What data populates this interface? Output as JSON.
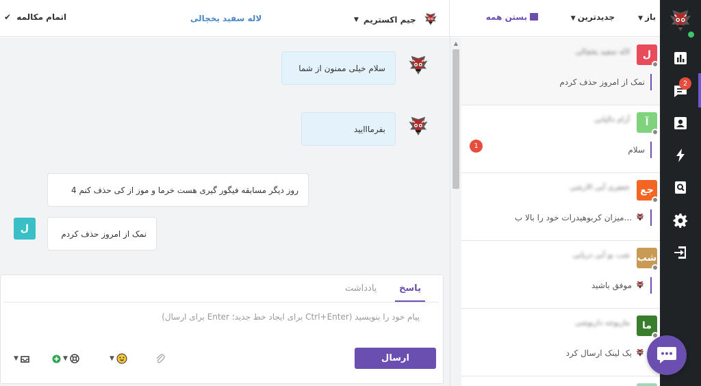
{
  "header": {
    "filter_open": "باز",
    "sort_newest": "جدیدترین",
    "close_all": "بستن همه",
    "finish_chat": "اتمام مکالمه",
    "contact_name": "لاله سفید یخچالی",
    "agent_name": "جیم اکستریم"
  },
  "nav": {
    "badge": "2",
    "icons": [
      "bar-chart-icon",
      "chat-icon",
      "contact-card-icon",
      "lightning-icon",
      "search-doc-icon",
      "gear-icon",
      "logout-icon"
    ]
  },
  "conversations": [
    {
      "avatar": "ل",
      "color": "#e84c5a",
      "name": "لاله سفید یخچالی",
      "last": "نمک از امروز حذف کردم",
      "unread": "",
      "agent_logo": false
    },
    {
      "avatar": "آ",
      "color": "#6fcf71",
      "name": "آرام دالیانی",
      "last": "سلام",
      "unread": "1",
      "agent_logo": false
    },
    {
      "avatar": "جع",
      "color": "#f26522",
      "name": "جعفری آیی الارشی",
      "last": "میزان کربوهیدرات خود را بالا ب...",
      "unread": "",
      "agent_logo": true
    },
    {
      "avatar": "شب",
      "color": "#c99a54",
      "name": "شب بو آبی دریایی",
      "last": "موفق باشید",
      "unread": "",
      "agent_logo": true
    },
    {
      "avatar": "ما",
      "color": "#3a7d2c",
      "name": "ماریوجه داریوشی",
      "last": "یک لینک ارسال کرد",
      "unread": "",
      "agent_logo": true
    }
  ],
  "messages": [
    {
      "text": "سلام خیلی ممنون از شما",
      "dir": "out"
    },
    {
      "text": "بفرمااایید",
      "dir": "out"
    },
    {
      "text": "4 روز دیگر مسابقه فیگور گیری هست خرما و موز از کی حذف کنم",
      "dir": "in"
    },
    {
      "text": "نمک از امروز حذف کردم",
      "dir": "in",
      "avatar": "ل"
    }
  ],
  "reply": {
    "tab_reply": "پاسخ",
    "tab_note": "یادداشت",
    "placeholder": "پیام خود را بنویسید (Ctrl+Enter برای ایجاد خط جدید؛ Enter برای ارسال)",
    "send": "ارسال"
  },
  "colors": {
    "accent": "#6a4eb0",
    "sidebar": "#1f2326",
    "contact_name": "#4a88c7",
    "badge": "#e84c3d"
  }
}
